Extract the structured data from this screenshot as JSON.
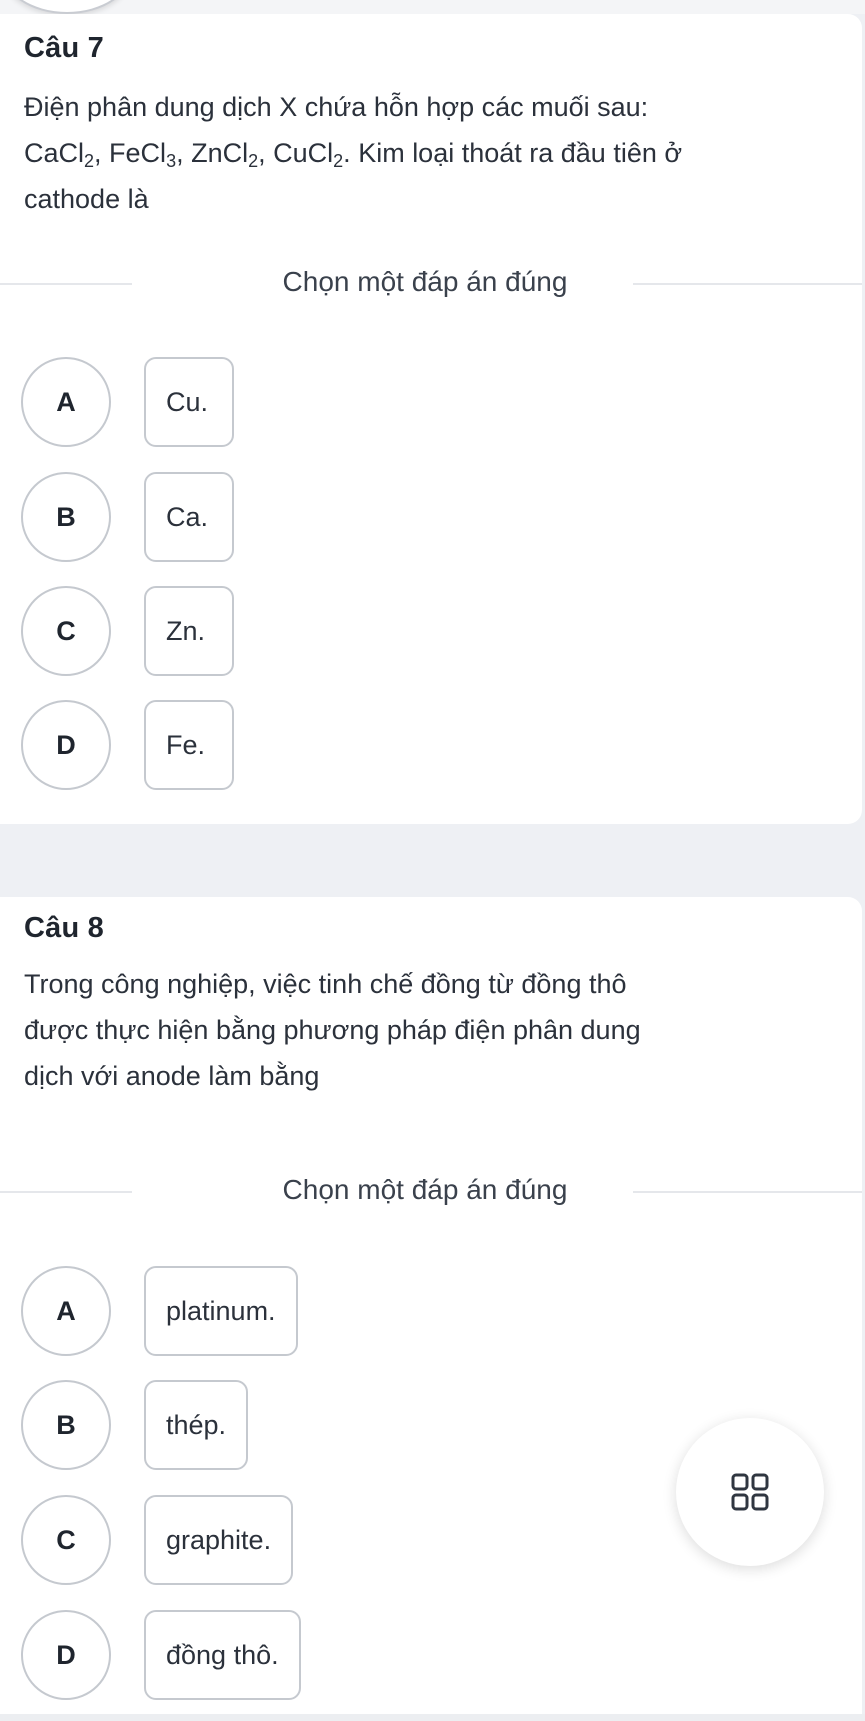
{
  "questions": [
    {
      "title": "Câu 7",
      "text_line1": "Điện phân dung dịch X chứa hỗn hợp các muối sau:",
      "formula_parts": [
        {
          "base": "CaCl",
          "sub": "2",
          "sep": ", "
        },
        {
          "base": "FeCl",
          "sub": "3",
          "sep": ", "
        },
        {
          "base": "ZnCl",
          "sub": "2",
          "sep": ", "
        },
        {
          "base": "CuCl",
          "sub": "2",
          "sep": ". "
        }
      ],
      "text_line2_rest": "Kim loại thoát ra đầu tiên ở",
      "text_line3": "cathode là",
      "instruction": "Chọn một đáp án đúng",
      "options": [
        {
          "letter": "A",
          "text": "Cu."
        },
        {
          "letter": "B",
          "text": "Ca."
        },
        {
          "letter": "C",
          "text": "Zn."
        },
        {
          "letter": "D",
          "text": "Fe."
        }
      ]
    },
    {
      "title": "Câu 8",
      "text": "Trong công nghiệp, việc tinh chế đồng từ đồng thô được thực hiện bằng phương pháp điện phân dung dịch với anode làm bằng",
      "text_lines": [
        "Trong công nghiệp, việc tinh chế đồng từ đồng thô",
        "được thực hiện bằng phương pháp điện phân dung",
        "dịch với anode làm bằng"
      ],
      "instruction": "Chọn một đáp án đúng",
      "options": [
        {
          "letter": "A",
          "text": "platinum."
        },
        {
          "letter": "B",
          "text": "thép."
        },
        {
          "letter": "C",
          "text": "graphite."
        },
        {
          "letter": "D",
          "text": "đồng thô."
        }
      ]
    }
  ],
  "fab": {
    "icon": "grid-icon",
    "color": "#2f3640"
  },
  "colors": {
    "page_background": "#eef0f4",
    "card_background": "#ffffff",
    "option_border": "#c5c9cf",
    "text": "#2b313b"
  }
}
